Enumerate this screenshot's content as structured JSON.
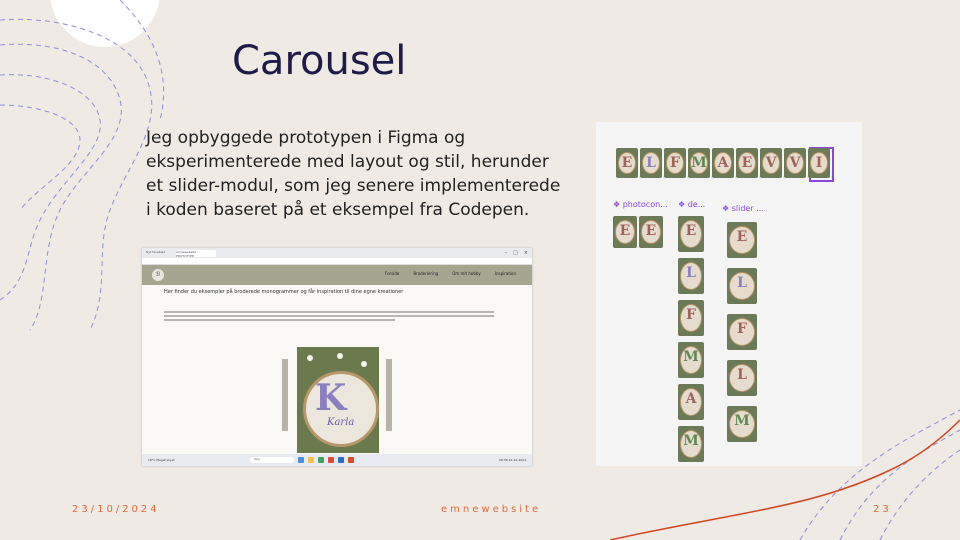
{
  "slide": {
    "title": "Carousel",
    "body": "Jeg opbyggede prototypen i Figma og eksperimenterede med layout og stil, herunder et slider-modul, som jeg senere implementerede i koden baseret på et eksempel fra Codepen.",
    "footer_date": "23/10/2024",
    "footer_center": "emnewebsite",
    "page_number": "23"
  },
  "colors": {
    "background": "#efeae4",
    "title": "#1e1b4b",
    "footer": "#e06b3d",
    "accent_figma": "#8b46e0",
    "nav_bar": "#a4a690"
  },
  "browser_screenshot": {
    "tabs": [
      "Nyt faneblad",
      "emnewebsite - PROTOTYPE"
    ],
    "site_nav": [
      "Forside",
      "Broderiering",
      "Om mit hobby",
      "Inspiration"
    ],
    "headline": "Her finder du eksempler på broderede monogrammer og får inspiration til dine egne kreationer",
    "slider_image_text": "Karla",
    "slider_image_letter": "K",
    "taskbar": {
      "weather": "18°C Meget skyet",
      "search": "Søg",
      "clock": "09:36 24-10-2024"
    }
  },
  "figma_panel": {
    "frame_labels": [
      "photocon...",
      "de...",
      "slider ..."
    ],
    "top_row_letters": [
      "E",
      "L",
      "F",
      "M",
      "A",
      "E",
      "V",
      "V",
      "I"
    ],
    "column1_letters": [
      "E",
      "E"
    ],
    "column2_letters": [
      "E",
      "L",
      "F",
      "M",
      "A",
      "M"
    ],
    "column3_letters": [
      "E",
      "L",
      "F",
      "L",
      "M"
    ]
  }
}
